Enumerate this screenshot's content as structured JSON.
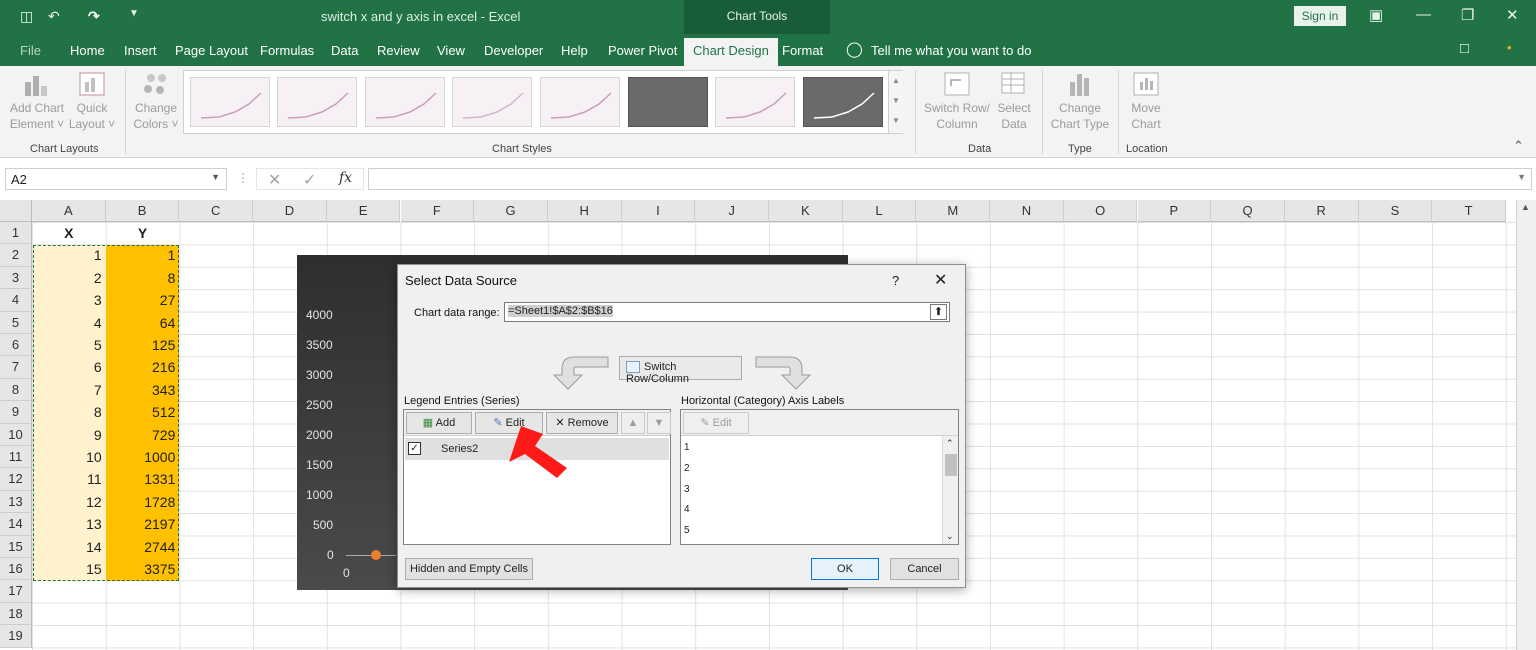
{
  "title_bar": {
    "document_title": "switch x and y axis in excel  -  Excel",
    "contextual_group": "Chart Tools",
    "sign_in": "Sign in"
  },
  "tabs": [
    "File",
    "Home",
    "Insert",
    "Page Layout",
    "Formulas",
    "Data",
    "Review",
    "View",
    "Developer",
    "Help",
    "Power Pivot",
    "Chart Design",
    "Format"
  ],
  "active_tab": "Chart Design",
  "tell_me": "Tell me what you want to do",
  "ribbon": {
    "add_chart_element": [
      "Add Chart",
      "Element ˅"
    ],
    "quick_layout": [
      "Quick",
      "Layout ˅"
    ],
    "chart_layouts_label": "Chart Layouts",
    "change_colors": [
      "Change",
      "Colors ˅"
    ],
    "chart_styles_label": "Chart Styles",
    "switch_row_column": [
      "Switch Row/",
      "Column"
    ],
    "select_data": [
      "Select",
      "Data"
    ],
    "data_label": "Data",
    "change_chart_type": [
      "Change",
      "Chart Type"
    ],
    "type_label": "Type",
    "move_chart": [
      "Move",
      "Chart"
    ],
    "location_label": "Location"
  },
  "formula_bar": {
    "name_box": "A2",
    "fx": "fx",
    "formula": ""
  },
  "sheet": {
    "columns": [
      "A",
      "B",
      "C",
      "D",
      "E",
      "F",
      "G",
      "H",
      "I",
      "J",
      "K",
      "L",
      "M",
      "N",
      "O",
      "P",
      "Q",
      "R",
      "S",
      "T"
    ],
    "rows": [
      "1",
      "2",
      "3",
      "4",
      "5",
      "6",
      "7",
      "8",
      "9",
      "10",
      "11",
      "12",
      "13",
      "14",
      "15",
      "16",
      "17",
      "18",
      "19"
    ],
    "headers": [
      "X",
      "Y"
    ],
    "x_values": [
      "1",
      "2",
      "3",
      "4",
      "5",
      "6",
      "7",
      "8",
      "9",
      "10",
      "11",
      "12",
      "13",
      "14",
      "15"
    ],
    "y_values": [
      "1",
      "8",
      "27",
      "64",
      "125",
      "216",
      "343",
      "512",
      "729",
      "1000",
      "1331",
      "1728",
      "2197",
      "2744",
      "3375"
    ]
  },
  "chart": {
    "y_ticks": [
      "4000",
      "3500",
      "3000",
      "2500",
      "2000",
      "1500",
      "1000",
      "500",
      "0"
    ],
    "x_tick": "0"
  },
  "dialog": {
    "title": "Select Data Source",
    "help": "?",
    "close": "✕",
    "range_label": "Chart data range:",
    "range_value": "=Sheet1!$A$2:$B$16",
    "switch_button": "Switch Row/Column",
    "legend_label": "Legend Entries (Series)",
    "add": "Add",
    "edit": "Edit",
    "remove": "Remove",
    "series": [
      "Series2"
    ],
    "axis_label": "Horizontal (Category) Axis Labels",
    "axis_edit": "Edit",
    "axis_items": [
      "1",
      "2",
      "3",
      "4",
      "5"
    ],
    "hidden_cells": "Hidden and Empty Cells",
    "ok": "OK",
    "cancel": "Cancel"
  }
}
